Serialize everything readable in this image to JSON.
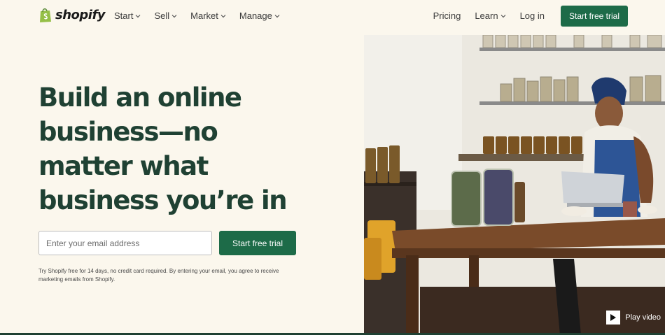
{
  "brand": {
    "name": "shopify",
    "color": "#95bf47",
    "accent": "#1d6b48",
    "headline_color": "#1f4133"
  },
  "nav": {
    "left": [
      {
        "label": "Start",
        "dropdown": true
      },
      {
        "label": "Sell",
        "dropdown": true
      },
      {
        "label": "Market",
        "dropdown": true
      },
      {
        "label": "Manage",
        "dropdown": true
      }
    ],
    "right": [
      {
        "label": "Pricing",
        "dropdown": false
      },
      {
        "label": "Learn",
        "dropdown": true
      },
      {
        "label": "Log in",
        "dropdown": false
      }
    ],
    "cta": "Start free trial"
  },
  "hero": {
    "headline_lines": [
      "Build an online",
      "business—no",
      "matter what",
      "business you’re in"
    ],
    "email_placeholder": "Enter your email address",
    "cta": "Start free trial",
    "disclaimer": "Try Shopify free for 14 days, no credit card required. By entering your email, you agree to receive marketing emails from Shopify.",
    "video_label": "Play video"
  },
  "icons": [
    "shopify-bag-icon",
    "chevron-down-icon",
    "play-icon"
  ]
}
